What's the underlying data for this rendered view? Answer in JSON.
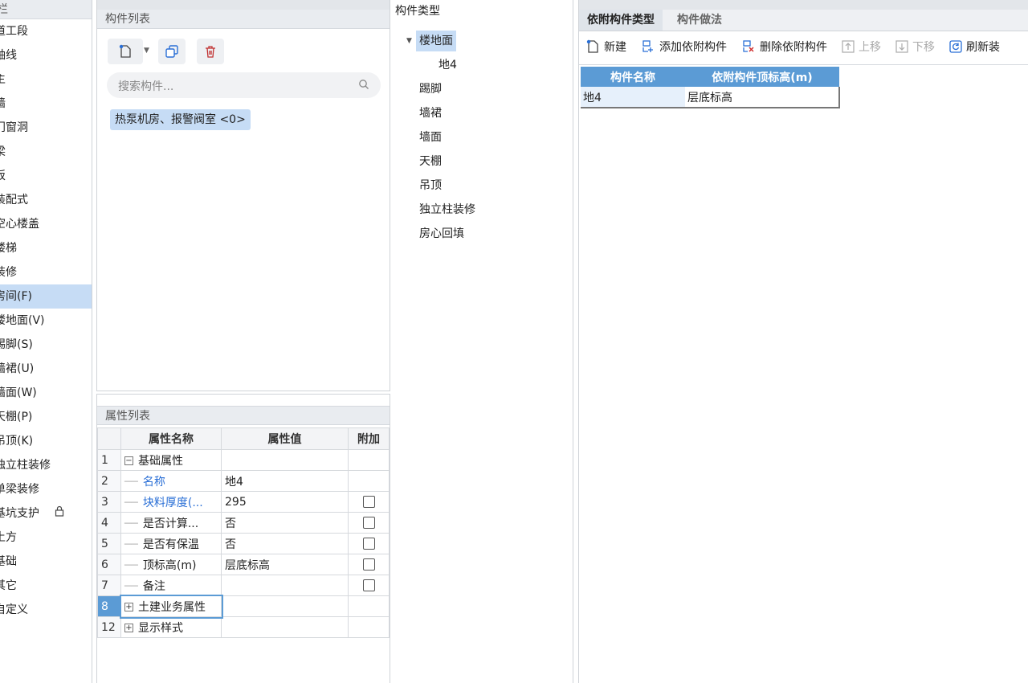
{
  "nav": {
    "header": "栏",
    "items": [
      {
        "label": "道工段"
      },
      {
        "label": "轴线"
      },
      {
        "label": "主"
      },
      {
        "label": "墙"
      },
      {
        "label": "门窗洞"
      },
      {
        "label": "梁"
      },
      {
        "label": "板"
      },
      {
        "label": "装配式"
      },
      {
        "label": "空心楼盖"
      },
      {
        "label": "楼梯"
      },
      {
        "label": "装修"
      },
      {
        "label": "房间(F)"
      },
      {
        "label": "楼地面(V)"
      },
      {
        "label": "踢脚(S)"
      },
      {
        "label": "墙裙(U)"
      },
      {
        "label": "墙面(W)"
      },
      {
        "label": "天棚(P)"
      },
      {
        "label": "吊顶(K)"
      },
      {
        "label": "独立柱装修"
      },
      {
        "label": "单梁装修"
      },
      {
        "label": "基坑支护"
      },
      {
        "label": "土方"
      },
      {
        "label": "基础"
      },
      {
        "label": "其它"
      },
      {
        "label": "自定义"
      }
    ],
    "selected_index": 11,
    "lock_item_index": 20
  },
  "component_list": {
    "header": "构件列表",
    "search_placeholder": "搜索构件...",
    "items": [
      {
        "label": "热泵机房、报警阀室 <0>"
      }
    ]
  },
  "properties": {
    "header": "属性列表",
    "columns": [
      "属性名称",
      "属性值",
      "附加"
    ],
    "rows": [
      {
        "num": "1",
        "name": "基础属性",
        "value": "",
        "expander": "−",
        "blue": false,
        "checkbox": false,
        "indent": false
      },
      {
        "num": "2",
        "name": "名称",
        "value": "地4",
        "expander": "",
        "blue": true,
        "checkbox": false,
        "indent": true
      },
      {
        "num": "3",
        "name": "块料厚度(...",
        "value": "295",
        "expander": "",
        "blue": true,
        "checkbox": true,
        "indent": true
      },
      {
        "num": "4",
        "name": "是否计算...",
        "value": "否",
        "expander": "",
        "blue": false,
        "checkbox": true,
        "indent": true
      },
      {
        "num": "5",
        "name": "是否有保温",
        "value": "否",
        "expander": "",
        "blue": false,
        "checkbox": true,
        "indent": true
      },
      {
        "num": "6",
        "name": "顶标高(m)",
        "value": "层底标高",
        "expander": "",
        "blue": false,
        "checkbox": true,
        "indent": true
      },
      {
        "num": "7",
        "name": "备注",
        "value": "",
        "expander": "",
        "blue": false,
        "checkbox": true,
        "indent": true
      },
      {
        "num": "8",
        "name": "土建业务属性",
        "value": "",
        "expander": "+",
        "blue": false,
        "checkbox": false,
        "indent": false
      },
      {
        "num": "12",
        "name": "显示样式",
        "value": "",
        "expander": "+",
        "blue": false,
        "checkbox": false,
        "indent": false
      }
    ],
    "selected_row": "8"
  },
  "types": {
    "title": "构件类型",
    "nodes": [
      {
        "label": "楼地面",
        "level": 0,
        "expanded": true,
        "selected": true
      },
      {
        "label": "地4",
        "level": 1,
        "expanded": false,
        "selected": false
      },
      {
        "label": "踢脚",
        "level": 0,
        "expanded": false,
        "selected": false
      },
      {
        "label": "墙裙",
        "level": 0,
        "expanded": false,
        "selected": false
      },
      {
        "label": "墙面",
        "level": 0,
        "expanded": false,
        "selected": false
      },
      {
        "label": "天棚",
        "level": 0,
        "expanded": false,
        "selected": false
      },
      {
        "label": "吊顶",
        "level": 0,
        "expanded": false,
        "selected": false
      },
      {
        "label": "独立柱装修",
        "level": 0,
        "expanded": false,
        "selected": false
      },
      {
        "label": "房心回填",
        "level": 0,
        "expanded": false,
        "selected": false
      }
    ]
  },
  "right": {
    "tabs": [
      {
        "label": "依附构件类型",
        "active": true
      },
      {
        "label": "构件做法",
        "active": false
      }
    ],
    "toolbar": {
      "new": "新建",
      "add_attached": "添加依附构件",
      "delete_attached": "删除依附构件",
      "move_up": "上移",
      "move_down": "下移",
      "refresh": "刷新装"
    },
    "table": {
      "columns": [
        "构件名称",
        "依附构件顶标高(m)"
      ],
      "rows": [
        {
          "name": "地4",
          "top_elev": "层底标高"
        }
      ]
    }
  },
  "colors": {
    "selection": "#c6dcf5",
    "header_blue": "#5b9bd5",
    "link_blue": "#2a6fd6"
  }
}
